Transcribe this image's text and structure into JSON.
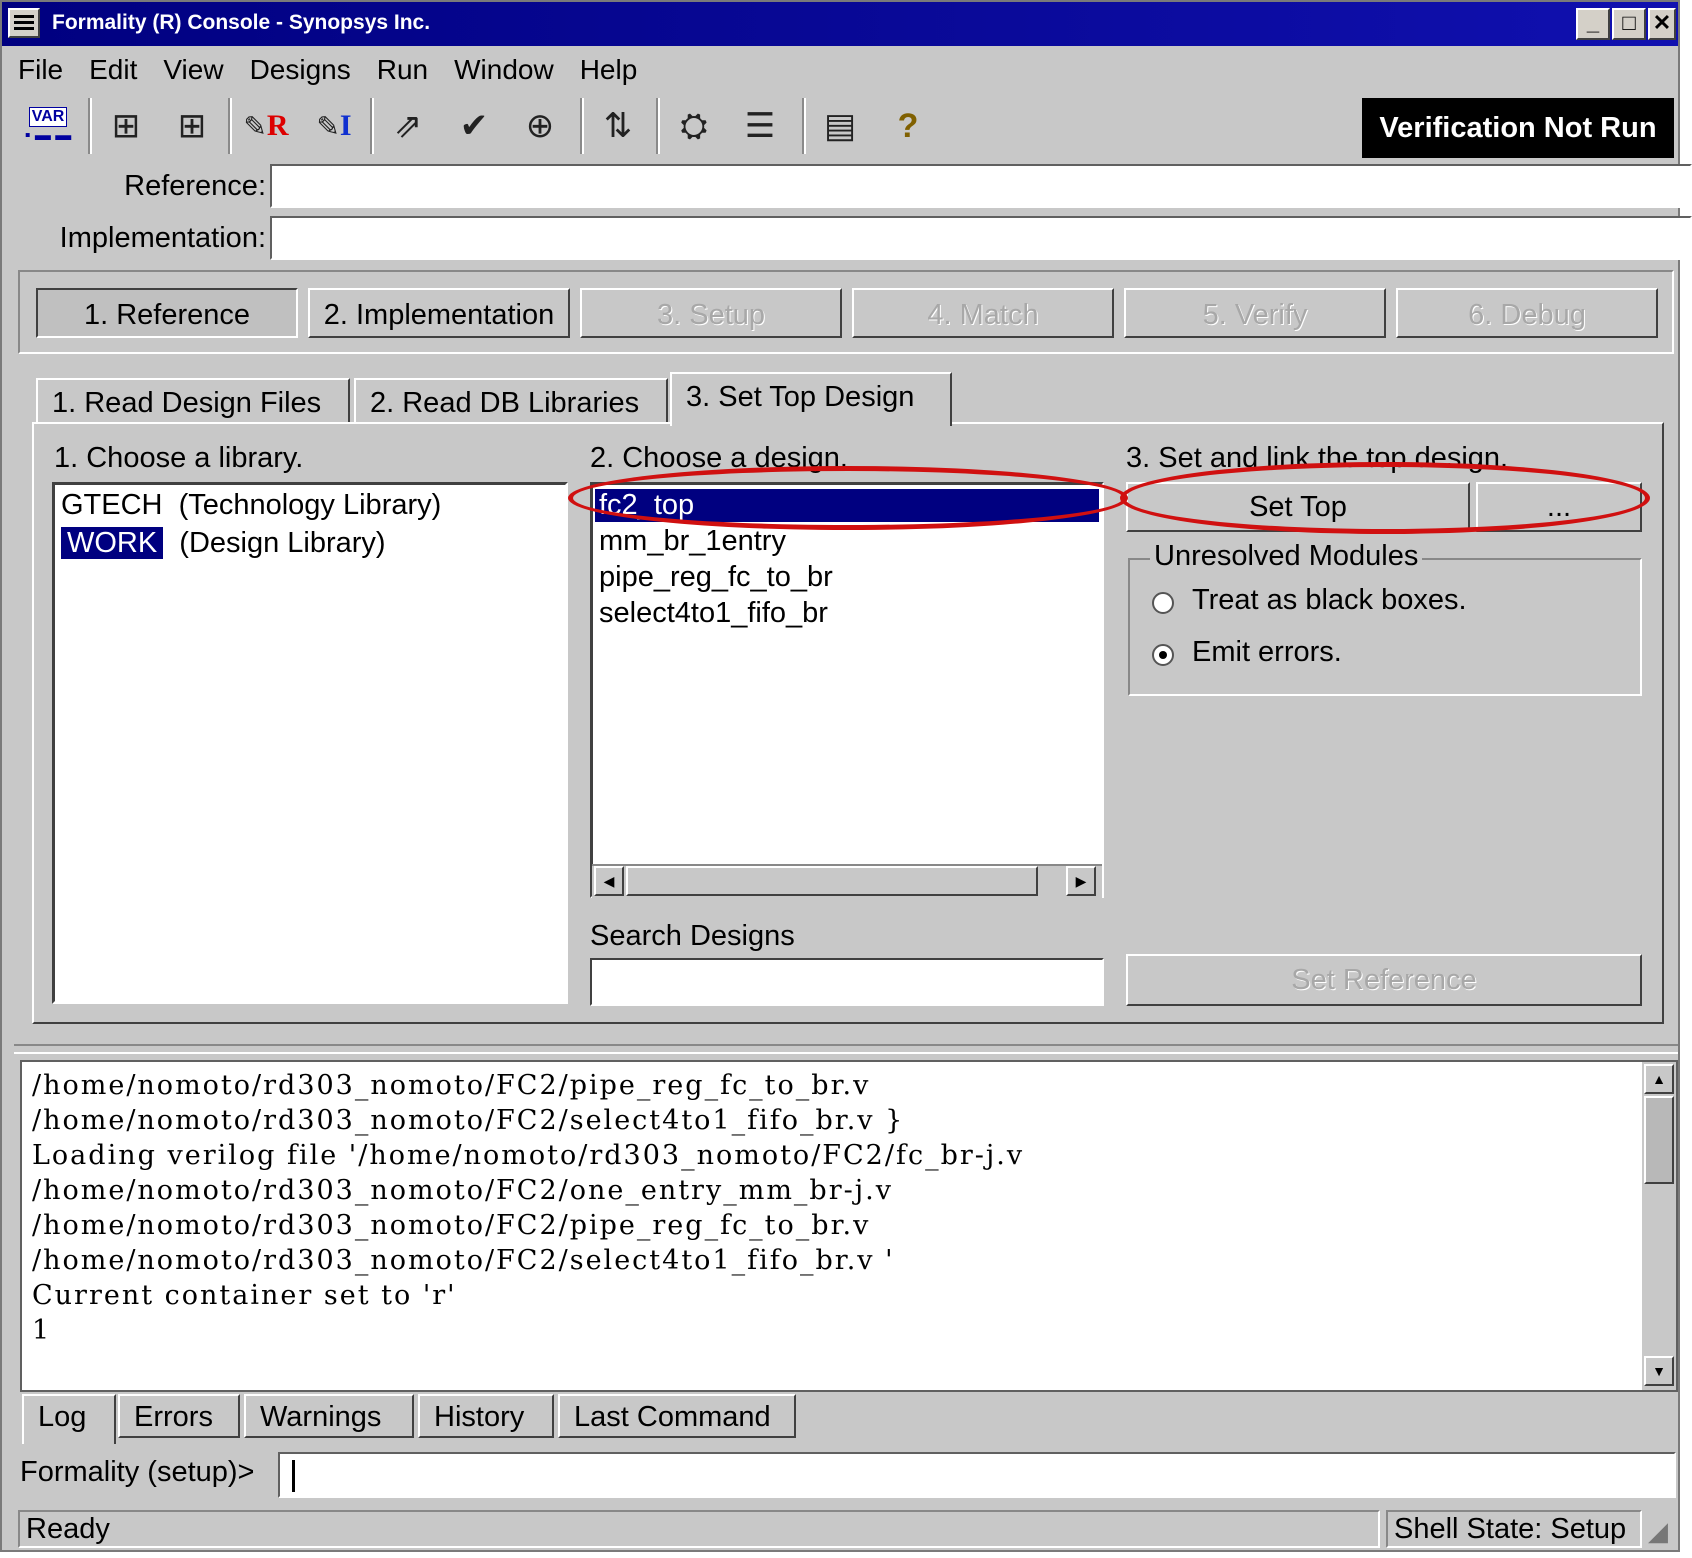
{
  "window": {
    "title": "Formality (R) Console - Synopsys Inc."
  },
  "menu": [
    "File",
    "Edit",
    "View",
    "Designs",
    "Run",
    "Window",
    "Help"
  ],
  "toolbar": {
    "icons": [
      "var-icon",
      "hierarchy-ref-icon",
      "hierarchy-impl-icon",
      "eraser-r-icon",
      "eraser-i-icon",
      "run-setup-icon",
      "run-match-icon",
      "run-verify-icon",
      "compare-icon",
      "binoculars-icon",
      "align-icon",
      "list-icon",
      "help-icon"
    ],
    "var_label": "VAR",
    "r_label": "R",
    "i_label": "I",
    "help_glyph": "?",
    "verification_status": "Verification Not Run"
  },
  "fields": {
    "reference_label": "Reference:",
    "reference_value": "",
    "implementation_label": "Implementation:",
    "implementation_value": ""
  },
  "steps": [
    {
      "label": "1. Reference",
      "state": "active"
    },
    {
      "label": "2. Implementation",
      "state": "enabled"
    },
    {
      "label": "3. Setup",
      "state": "disabled"
    },
    {
      "label": "4. Match",
      "state": "disabled"
    },
    {
      "label": "5. Verify",
      "state": "disabled"
    },
    {
      "label": "6. Debug",
      "state": "disabled"
    }
  ],
  "tabs": [
    {
      "label": "1. Read Design Files"
    },
    {
      "label": "2. Read DB Libraries"
    },
    {
      "label": "3. Set Top Design",
      "active": true
    }
  ],
  "library": {
    "heading": "1. Choose a library.",
    "items": [
      {
        "name": "GTECH",
        "desc": "(Technology Library)",
        "selected": false
      },
      {
        "name": "WORK",
        "desc": "(Design Library)",
        "selected": true
      }
    ]
  },
  "design": {
    "heading": "2. Choose a design.",
    "items": [
      "fc2_top",
      "mm_br_1entry",
      "pipe_reg_fc_to_br",
      "select4to1_fifo_br"
    ],
    "selected_index": 0,
    "search_label": "Search Designs",
    "search_value": ""
  },
  "top": {
    "heading": "3. Set and link the top design.",
    "set_top_label": "Set Top",
    "browse_label": "...",
    "group_title": "Unresolved Modules",
    "options": [
      {
        "label": "Treat as black boxes.",
        "checked": false
      },
      {
        "label": "Emit errors.",
        "checked": true
      }
    ],
    "set_reference_label": "Set Reference"
  },
  "log": {
    "lines": [
      "/home/nomoto/rd303_nomoto/FC2/pipe_reg_fc_to_br.v",
      "/home/nomoto/rd303_nomoto/FC2/select4to1_fifo_br.v }",
      "Loading verilog file '/home/nomoto/rd303_nomoto/FC2/fc_br-j.v",
      "/home/nomoto/rd303_nomoto/FC2/one_entry_mm_br-j.v",
      "/home/nomoto/rd303_nomoto/FC2/pipe_reg_fc_to_br.v",
      "/home/nomoto/rd303_nomoto/FC2/select4to1_fifo_br.v '",
      "Current container set to 'r'",
      "1"
    ],
    "tabs": [
      "Log",
      "Errors",
      "Warnings",
      "History",
      "Last Command"
    ],
    "active_tab": 0
  },
  "prompt": {
    "label": "Formality (setup)>",
    "value": ""
  },
  "status": {
    "left": "Ready",
    "right": "Shell State: Setup"
  },
  "colors": {
    "title_bar": "#000080",
    "selection": "#000080",
    "annotation": "#d01010"
  }
}
